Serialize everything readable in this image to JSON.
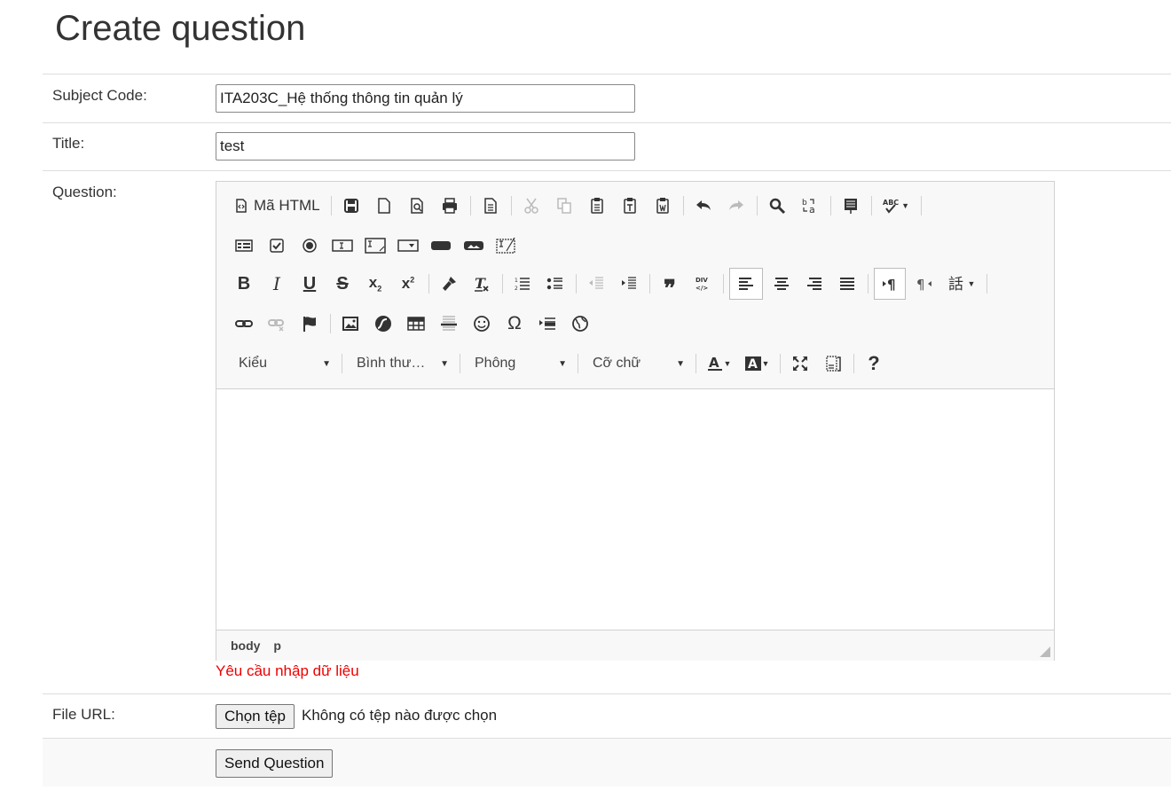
{
  "page_title": "Create question",
  "form": {
    "subject_label": "Subject Code:",
    "subject_value": "ITA203C_Hệ thống thông tin quản lý",
    "title_label": "Title:",
    "title_value": "test",
    "question_label": "Question:",
    "file_label": "File URL:",
    "file_button": "Chọn tệp",
    "file_status": "Không có tệp nào được chọn",
    "submit_label": "Send Question",
    "validation_error": "Yêu cầu nhập dữ liệu"
  },
  "editor": {
    "source_label": "Mã HTML",
    "combos": {
      "styles": "Kiểu",
      "format": "Bình thư…",
      "font": "Phông",
      "size": "Cỡ chữ"
    },
    "path": [
      "body",
      "p"
    ]
  },
  "colors": {
    "error": "#e00000",
    "border": "#d1d1d1"
  }
}
